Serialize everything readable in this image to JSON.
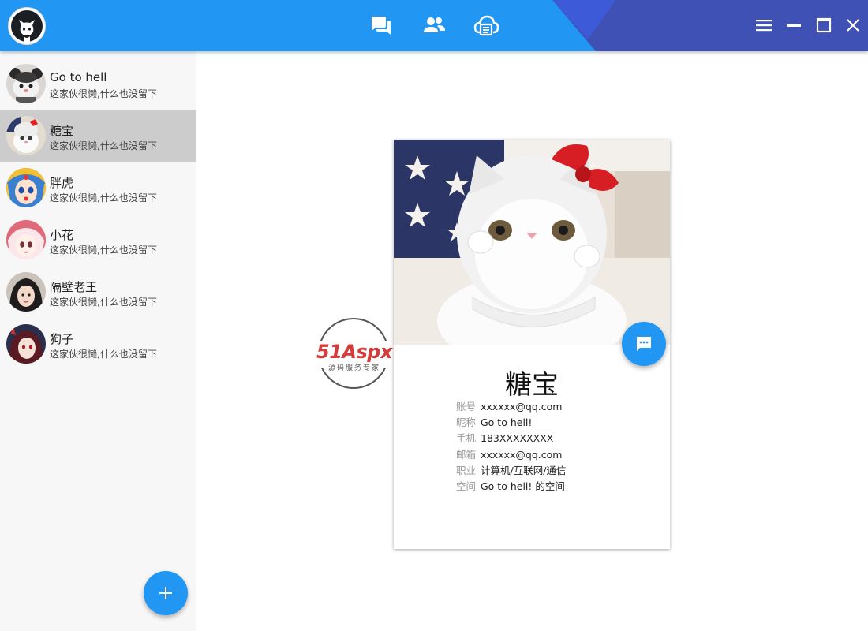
{
  "colors": {
    "accent": "#2196f3",
    "accent_dark": "#3f51b5",
    "sidebar_bg": "#f7f7f7",
    "selected_bg": "#cccccc"
  },
  "topbar": {
    "logo_icon": "github-cat-icon",
    "nav": [
      {
        "icon": "chat-icon"
      },
      {
        "icon": "contacts-icon"
      },
      {
        "icon": "cloud-message-icon"
      }
    ],
    "window_controls": [
      {
        "icon": "menu-icon"
      },
      {
        "icon": "minimize-icon"
      },
      {
        "icon": "maximize-icon"
      },
      {
        "icon": "close-icon"
      }
    ]
  },
  "sidebar": {
    "contacts": [
      {
        "name": "Go to hell",
        "signature": "这家伙很懒,什么也没留下",
        "selected": false
      },
      {
        "name": "糖宝",
        "signature": "这家伙很懒,什么也没留下",
        "selected": true
      },
      {
        "name": "胖虎",
        "signature": "这家伙很懒,什么也没留下",
        "selected": false
      },
      {
        "name": "小花",
        "signature": "这家伙很懒,什么也没留下",
        "selected": false
      },
      {
        "name": "隔壁老王",
        "signature": "这家伙很懒,什么也没留下",
        "selected": false
      },
      {
        "name": "狗子",
        "signature": "这家伙很懒,什么也没留下",
        "selected": false
      }
    ],
    "add_button_icon": "plus-icon"
  },
  "profile": {
    "name": "糖宝",
    "chat_button_icon": "chat-bubble-icon",
    "fields": [
      {
        "label": "账号",
        "value": "xxxxxx@qq.com"
      },
      {
        "label": "昵称",
        "value": "Go to hell!"
      },
      {
        "label": "手机",
        "value": "183XXXXXXXX"
      },
      {
        "label": "邮箱",
        "value": "xxxxxx@qq.com"
      },
      {
        "label": "职业",
        "value": "计算机/互联网/通信"
      },
      {
        "label": "空间",
        "value": "Go to hell! 的空间"
      }
    ]
  },
  "watermark": {
    "brand": "51Aspx",
    "tagline": "源码服务专家"
  }
}
